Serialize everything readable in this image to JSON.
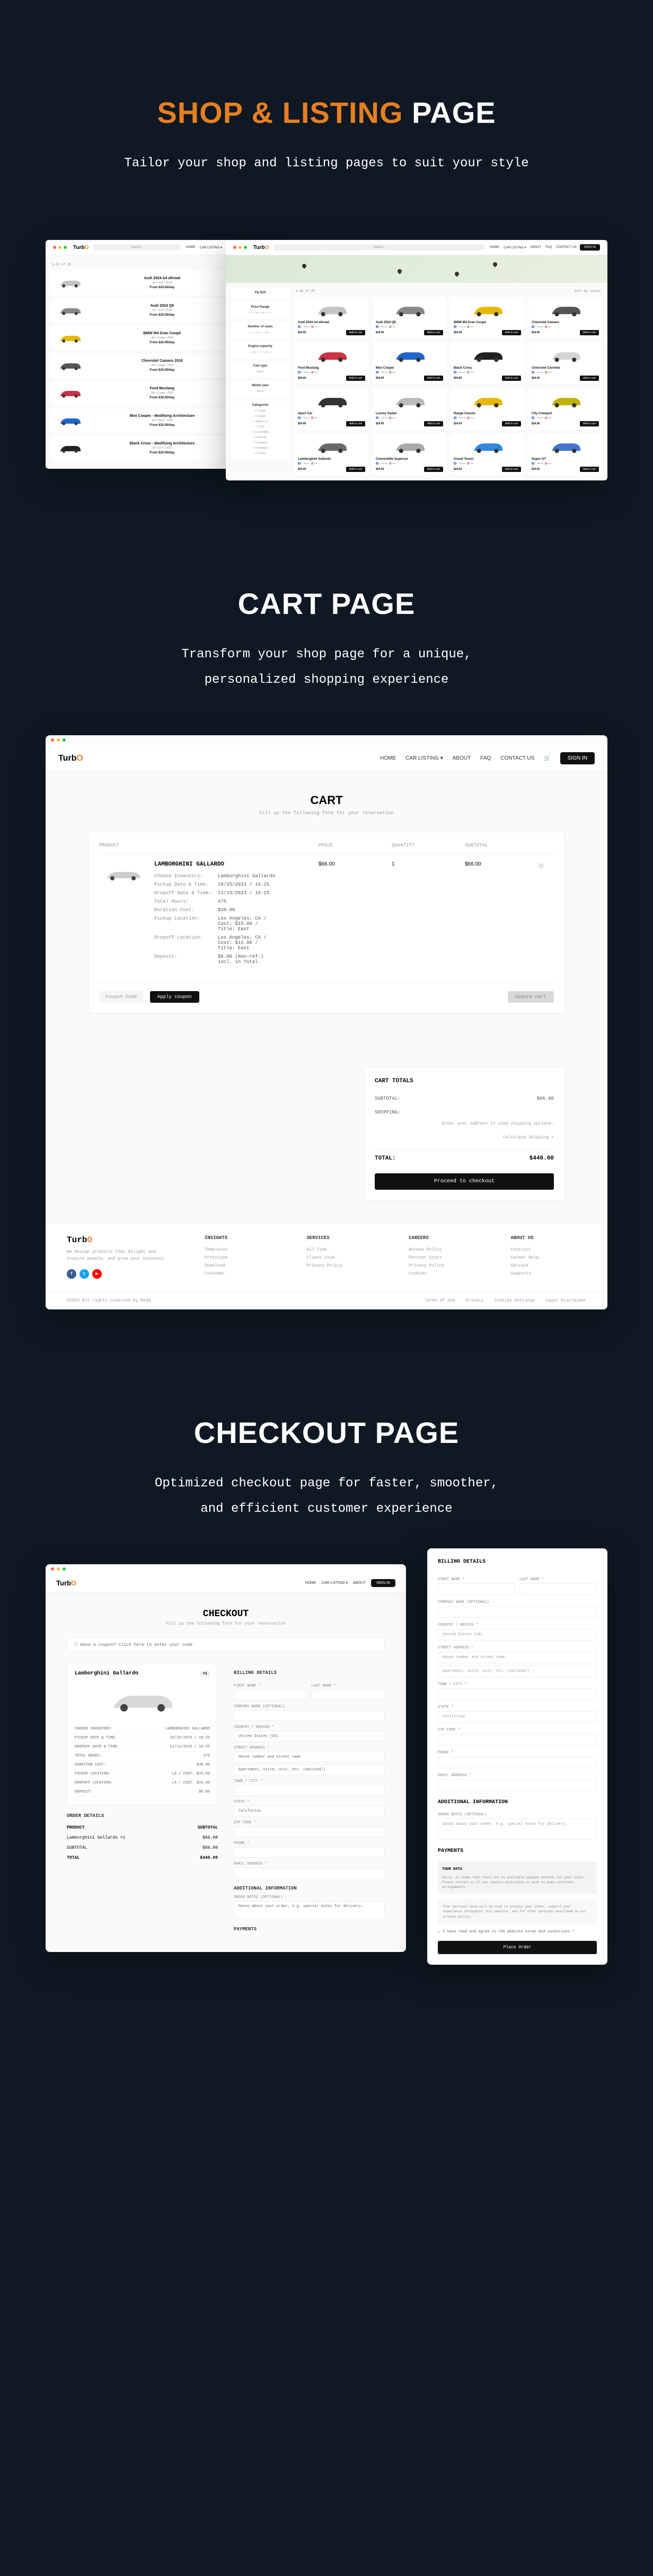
{
  "sections": {
    "shop": {
      "title_orange": "SHOP & LISTING",
      "title_white": " PAGE",
      "desc": "Tailor your shop and listing pages to suit your style"
    },
    "cart": {
      "title_white": "CART PAGE",
      "desc_l1": "Transform your shop page for a unique,",
      "desc_l2": "personalized shopping experience"
    },
    "checkout": {
      "title_white": "CHECKOUT PAGE",
      "desc_l1": "Optimized checkout page for faster, smoother,",
      "desc_l2": "and efficient customer experience"
    }
  },
  "brand": {
    "t": "Turb",
    "o": "O"
  },
  "nav": [
    "HOME",
    "CAR LISTING ▾",
    "ABOUT",
    "FAQ",
    "CONTACT US"
  ],
  "signin": "SIGN IN",
  "search_placeholder": "Search...",
  "listings": [
    {
      "title": "Audi 2024 A4 allroad",
      "meta": "★5 • SUV • 2024",
      "price": "From $24.00/day",
      "color": "#c4c4c4"
    },
    {
      "title": "Audi 2024 Q5",
      "meta": "★5 • SUV • 2024",
      "price": "From $20.00/day",
      "color": "#888"
    },
    {
      "title": "BMW M4 Gran Coupé",
      "meta": "★5 • Coupe • 2024",
      "price": "From $26.00/day",
      "color": "#e8b800"
    },
    {
      "title": "Chevrolet Camaro 2016",
      "meta": "★4 • Coupe • 2016",
      "price": "From $20.00/day",
      "color": "#555"
    },
    {
      "title": "Ford Mustang",
      "meta": "★5 • Coupe • 2022",
      "price": "From $30.00/day",
      "color": "#cc3344"
    },
    {
      "title": "Mini Cooper - Modifying Architecture",
      "meta": "★4 • Hatch • 2020",
      "price": "From $20.00/day",
      "color": "#2266cc"
    },
    {
      "title": "Black Cross - Modifying Architecture",
      "meta": "★4 • SUV • 2021",
      "price": "From $20.00/day",
      "color": "#222"
    }
  ],
  "sort_label": "1-16 of 20",
  "sort_by": "Sort by latest",
  "filter": {
    "title": "FILTER",
    "price": "Price Range",
    "seats": "Number of seats",
    "engine": "Engine capacity",
    "fuel": "Fuel type",
    "model": "Model year",
    "categories": "Categories",
    "cat_items": [
      "Coupé",
      "Sedan",
      "Sports car",
      "SUV",
      "Convertible",
      "Minivan",
      "Compact",
      "Hatchback",
      "Luxury"
    ]
  },
  "grid_cards": [
    {
      "t": "Audi 2024 A4 allroad",
      "c": "#c4c4c4"
    },
    {
      "t": "Audi 2024 Q5",
      "c": "#888"
    },
    {
      "t": "BMW M4 Gran Coupé",
      "c": "#e8b800"
    },
    {
      "t": "Chevrolet Camaro",
      "c": "#555"
    },
    {
      "t": "Ford Mustang",
      "c": "#cc3344"
    },
    {
      "t": "Mini Cooper",
      "c": "#2266cc"
    },
    {
      "t": "Black Cross",
      "c": "#222"
    },
    {
      "t": "Chevrolet Corvette",
      "c": "#d4d4d4"
    },
    {
      "t": "Sport Car",
      "c": "#333"
    },
    {
      "t": "Luxury Sedan",
      "c": "#bbb"
    },
    {
      "t": "Range Classic",
      "c": "#e8b800"
    },
    {
      "t": "City Compact",
      "c": "#c4b000"
    },
    {
      "t": "Lamborghini Gallardo",
      "c": "#6a6a6a"
    },
    {
      "t": "Convertible Supercar",
      "c": "#aaa"
    },
    {
      "t": "Grand Tourer",
      "c": "#3388dd"
    },
    {
      "t": "Super GT",
      "c": "#4477cc"
    }
  ],
  "card_meta": [
    "♿4",
    "⚙Auto",
    "⛽Gas"
  ],
  "card_price": "$24.00",
  "add_cart": "Add to cart",
  "cart": {
    "title": "CART",
    "sub": "Fill up the following form for your reservation",
    "headers": [
      "PRODUCT",
      "PRICE",
      "QUANTITY",
      "SUBTOTAL"
    ],
    "product": {
      "name": "LAMBORGHINI GALLARDO",
      "lines": [
        [
          "Choose Inventory:",
          "Lamborghini Gallardo"
        ],
        [
          "Pickup Date & Time:",
          "10/25/2023 / 16:25"
        ],
        [
          "Dropoff Date & Time:",
          "11/13/2023 / 16:25"
        ],
        [
          "Total Hours:",
          "475"
        ],
        [
          "Duration Cost:",
          "$38.00"
        ],
        [
          "Pickup Location:",
          "Los Angeles, CA /\nCost: $15.00 /\nTitle: East"
        ],
        [
          "Dropoff Location:",
          "Los Angeles, CA /\nCost: $15.00 /\nTitle: East"
        ],
        [
          "Deposit:",
          "$0.00 (Non-ref.)\nincl. in Total"
        ]
      ],
      "price": "$66.00",
      "qty": "1",
      "subtotal": "$66.00"
    },
    "coupon_placeholder": "Coupon Code",
    "apply": "Apply coupon",
    "update": "Update cart",
    "totals": {
      "title": "CART TOTALS",
      "subtotal_l": "SUBTOTAL:",
      "subtotal_v": "$66.00",
      "shipping_l": "SHIPPING:",
      "shipping_note": "Enter your address to view shipping options.",
      "shipping_calc": "Calculate Shipping ▸",
      "total_l": "TOTAL:",
      "total_v": "$446.00",
      "proceed": "Proceed to checkout"
    }
  },
  "footer": {
    "tagline": "We design products that delight and inspire people, and grow your business.",
    "cols": [
      {
        "title": "INSIGHTS",
        "links": [
          "Templates",
          "Prototype",
          "Download",
          "Customer"
        ]
      },
      {
        "title": "SERVICES",
        "links": [
          "All Time",
          "Client Love",
          "Privacy Policy"
        ]
      },
      {
        "title": "CAREERS",
        "links": [
          "Bureau Policy",
          "Partner Story",
          "Privacy Policy",
          "Cookies"
        ]
      },
      {
        "title": "ABOUT US",
        "links": [
          "Contract",
          "Career Help",
          "Service",
          "Supports"
        ]
      }
    ],
    "copyright": "©2023 All rights reserved by RedQ",
    "bottom_links": [
      "Terms Of Use",
      "Privacy",
      "Cookies Settings",
      "Legal Disclaimer"
    ]
  },
  "checkout": {
    "title": "CHECKOUT",
    "sub": "Fill up the following form for your reservation",
    "notice": "ⓘ Have a coupon? Click here to enter your code",
    "product_name": "Lamborghini Gallardo",
    "qty_badge": "×1",
    "details": [
      [
        "CHOOSE INVENTORY:",
        "LAMBORGHINI GALLARDO"
      ],
      [
        "PICKUP DATE & TIME:",
        "10/25/2023 / 16:25"
      ],
      [
        "DROPOFF DATE & TIME:",
        "11/13/2023 / 16:25"
      ],
      [
        "TOTAL HOURS:",
        "475"
      ],
      [
        "DURATION COST:",
        "$38.00"
      ],
      [
        "PICKUP LOCATION:",
        "LA / COST: $15.00"
      ],
      [
        "DROPOFF LOCATION:",
        "LA / COST: $15.00"
      ],
      [
        "DEPOSIT:",
        "$0.00"
      ]
    ],
    "order_title": "ORDER DETAILS",
    "order": [
      [
        "PRODUCT",
        "SUBTOTAL"
      ],
      [
        "Lamborghini Gallardo ×1",
        "$66.00"
      ],
      [
        "SUBTOTAL",
        "$66.00"
      ],
      [
        "TOTAL",
        "$446.00"
      ]
    ],
    "billing_title": "BILLING DETAILS",
    "fields": {
      "fname": "FIRST NAME *",
      "lname": "LAST NAME *",
      "company": "COMPANY NAME (OPTIONAL)",
      "country": "COUNTRY / REGION *",
      "country_v": "United States (US)",
      "street": "STREET ADDRESS *",
      "street_ph": "House number and street name",
      "apt_ph": "Apartment, suite, unit, etc. (optional)",
      "city": "TOWN / CITY *",
      "state": "STATE *",
      "state_v": "California",
      "zip": "ZIP CODE *",
      "phone": "PHONE *",
      "email": "EMAIL ADDRESS *"
    },
    "additional": "ADDITIONAL INFORMATION",
    "notes_label": "ORDER NOTES (OPTIONAL)",
    "notes_ph": "Notes about your order, e.g. special notes for delivery.",
    "payments_title": "PAYMENTS",
    "your_data_title": "YOUR DATA",
    "your_data_body": "Sorry, it seems that there are no available payment methods for your state. Please contact us if you require assistance or wish to make alternate arrangements.",
    "privacy": "Your personal data will be used to process your order, support your experience throughout this website, and for other purposes described in our privacy policy.",
    "terms_check": "I have read and agree to the website terms and conditions *",
    "place": "Place Order"
  }
}
